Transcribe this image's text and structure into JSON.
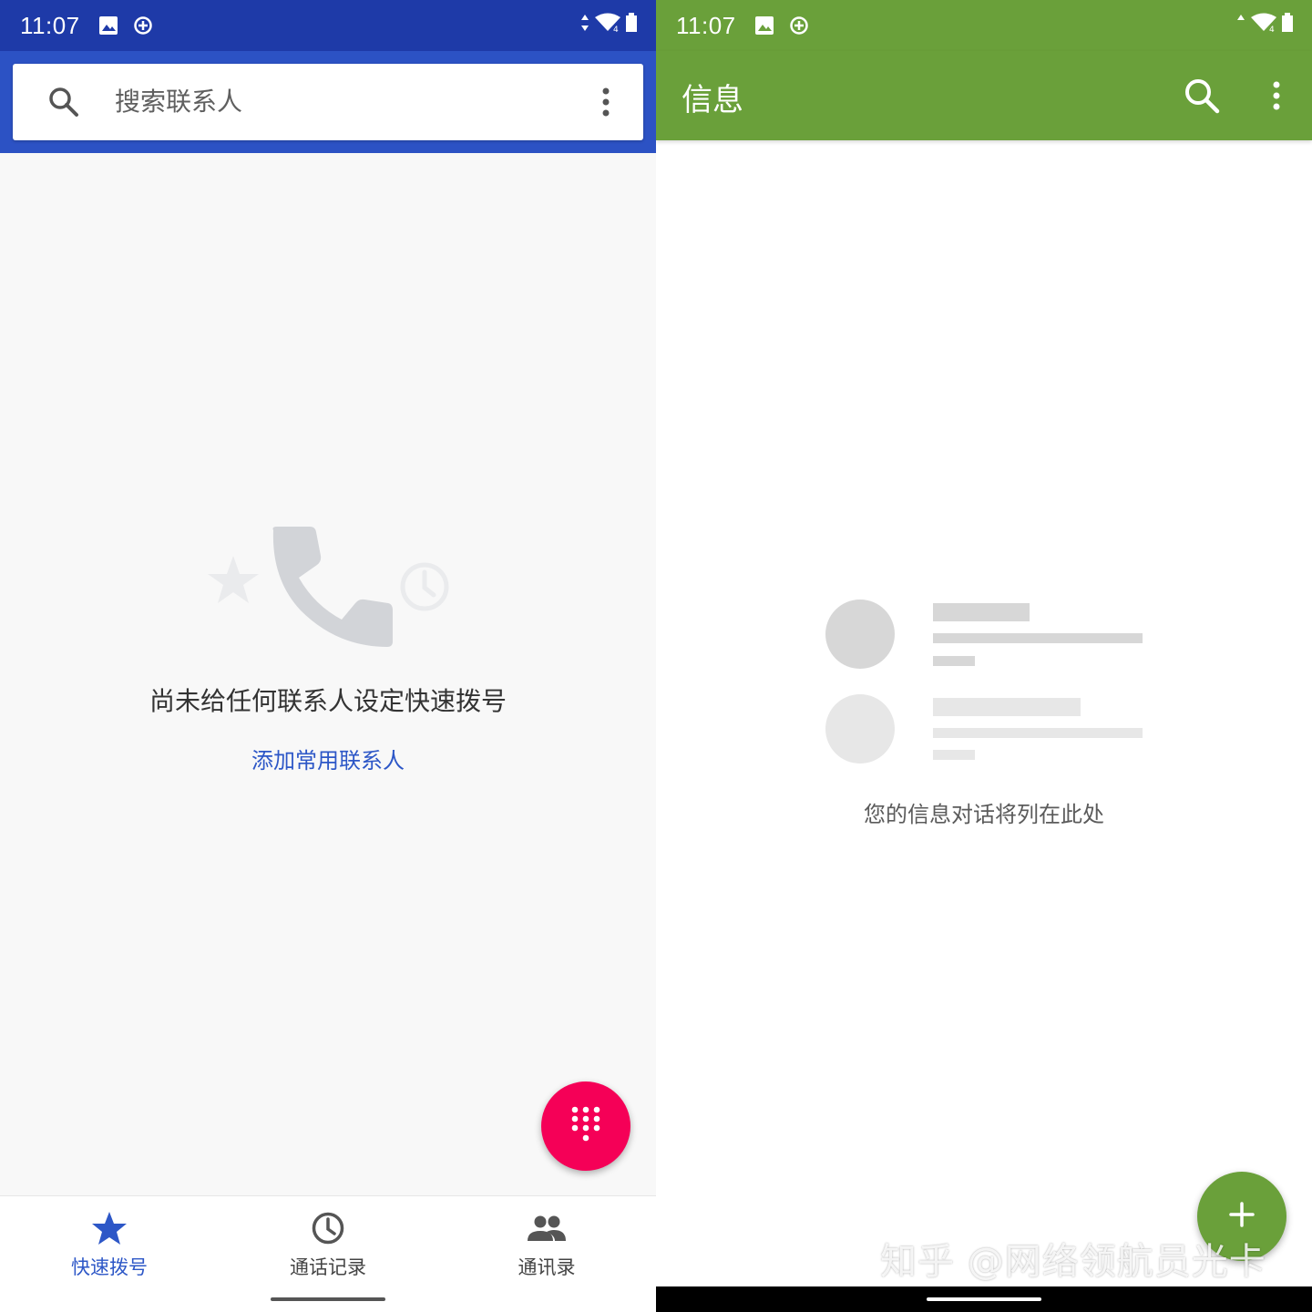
{
  "phone": {
    "status_time": "11:07",
    "search_placeholder": "搜索联系人",
    "empty_title": "尚未给任何联系人设定快速拨号",
    "empty_link": "添加常用联系人",
    "nav": [
      {
        "label": "快速拨号",
        "icon": "star-icon",
        "active": true
      },
      {
        "label": "通话记录",
        "icon": "clock-icon",
        "active": false
      },
      {
        "label": "通讯录",
        "icon": "people-icon",
        "active": false
      }
    ],
    "colors": {
      "status_bar": "#1e3aa8",
      "header": "#2c52c4",
      "accent": "#2d57c7",
      "fab": "#f50057"
    }
  },
  "messages": {
    "status_time": "11:07",
    "title": "信息",
    "empty_text": "您的信息对话将列在此处",
    "watermark": "知乎 @网络领航员光卡",
    "colors": {
      "app_bar": "#6aa03a",
      "fab": "#6aa03a"
    }
  }
}
